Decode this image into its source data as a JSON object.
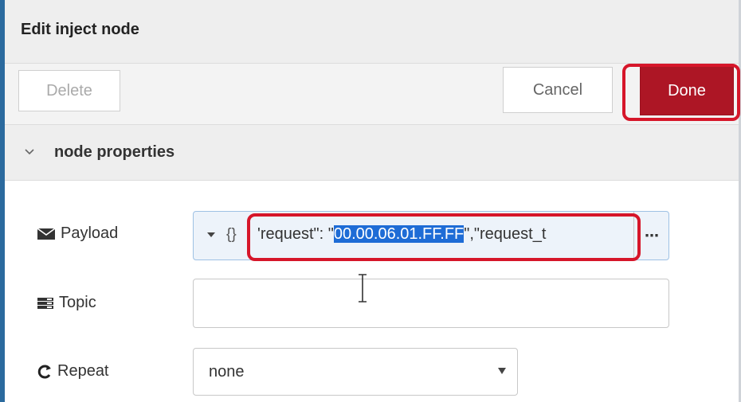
{
  "dialog": {
    "title": "Edit inject node"
  },
  "toolbar": {
    "delete_label": "Delete",
    "cancel_label": "Cancel",
    "done_label": "Done"
  },
  "section": {
    "title": "node properties"
  },
  "fields": {
    "payload": {
      "label": "Payload",
      "type_label": "{}",
      "value_prefix": "'request\": \"",
      "value_selected": "00.00.06.01.FF.FF",
      "value_suffix": "\",\"request_t",
      "more_label": "⋯"
    },
    "topic": {
      "label": "Topic",
      "value": ""
    },
    "repeat": {
      "label": "Repeat",
      "selected": "none"
    }
  },
  "colors": {
    "done_button": "#ad1625",
    "highlight": "#d6162a",
    "selection": "#1e6cd6"
  },
  "icons": [
    "chevron-down-icon",
    "envelope-icon",
    "tasks-icon",
    "repeat-icon",
    "caret-down-icon",
    "text-cursor-icon"
  ]
}
